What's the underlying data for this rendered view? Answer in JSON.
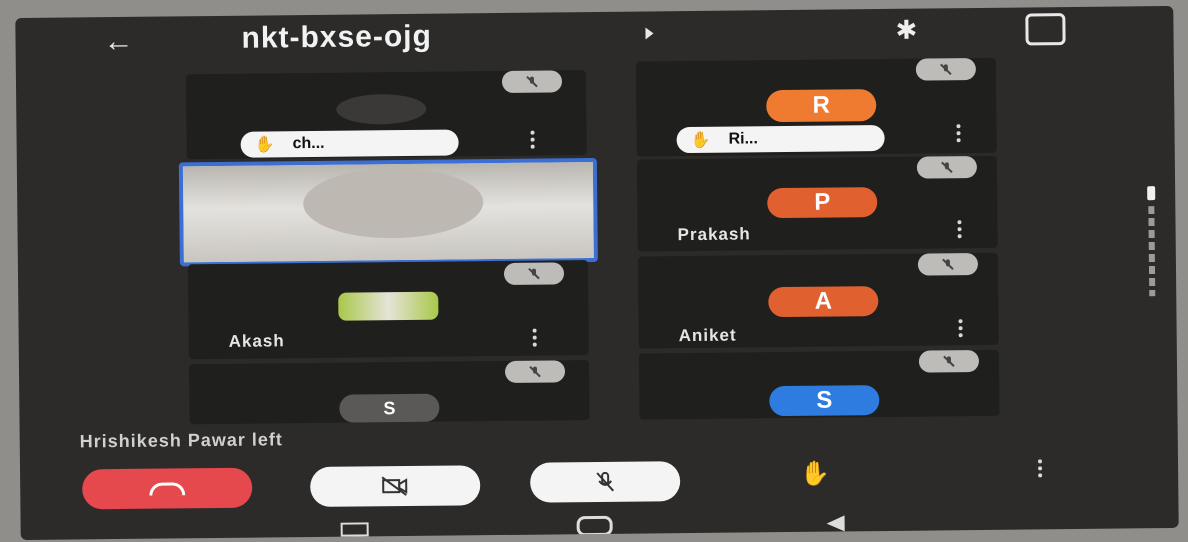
{
  "header": {
    "back_icon": "arrow-left-icon",
    "meeting_code": "nkt-bxse-ojg",
    "bluetooth_icon": "bluetooth-icon",
    "switch_camera_icon": "switch-camera-icon"
  },
  "participants": [
    {
      "name": "ch...",
      "avatar_letter": "",
      "hand_raised": true,
      "muted": true
    },
    {
      "name": "Ri...",
      "avatar_letter": "R",
      "avatar_color": "#ee7b30",
      "hand_raised": true,
      "muted": true
    },
    {
      "name": "",
      "avatar_letter": "",
      "muted": false,
      "active_speaker": true
    },
    {
      "name": "Prakash",
      "avatar_letter": "P",
      "avatar_color": "#e06030",
      "muted": true
    },
    {
      "name": "Akash",
      "avatar_letter": "",
      "muted": true
    },
    {
      "name": "Aniket",
      "avatar_letter": "A",
      "avatar_color": "#e06030",
      "muted": true
    },
    {
      "name": "",
      "avatar_letter": "S",
      "avatar_color": "#5a5957",
      "muted": true
    },
    {
      "name": "",
      "avatar_letter": "S",
      "avatar_color": "#2e7ce0",
      "muted": true
    }
  ],
  "notification": "Hrishikesh Pawar left",
  "controls": {
    "end_call_icon": "end-call-icon",
    "camera_off_icon": "camera-off-icon",
    "mic_off_icon": "mic-off-icon",
    "raise_hand_icon": "raise-hand-icon",
    "more_icon": "more-vert-icon",
    "end_call_color": "#e5484d"
  }
}
